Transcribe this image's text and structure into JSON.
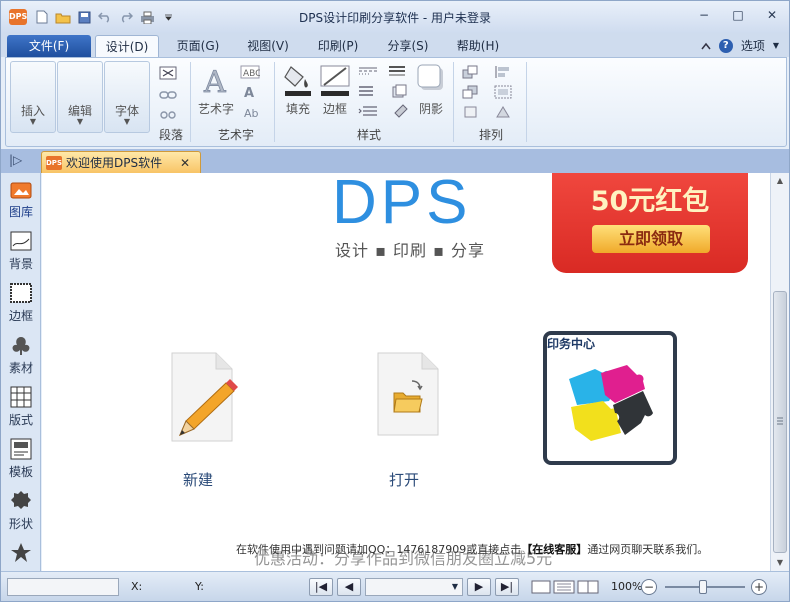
{
  "window": {
    "app_logo": "DPS",
    "title": "DPS设计印刷分享软件 - 用户未登录",
    "controls": {
      "minimize": "−",
      "restore": "□",
      "close": "✕"
    }
  },
  "quick_access": [
    "new-doc-icon",
    "open-folder-icon",
    "save-icon",
    "undo-icon",
    "redo-icon",
    "print-icon",
    "customize-arrow-icon"
  ],
  "ribbon_tabs": {
    "file": "文件(F)",
    "tabs": [
      {
        "label": "设计(D)",
        "active": true
      },
      {
        "label": "页面(G)",
        "active": false
      },
      {
        "label": "视图(V)",
        "active": false
      },
      {
        "label": "印刷(P)",
        "active": false
      },
      {
        "label": "分享(S)",
        "active": false
      },
      {
        "label": "帮助(H)",
        "active": false
      }
    ],
    "options_label": "选项",
    "help_glyph": "?"
  },
  "ribbon": {
    "insert": "插入",
    "edit": "编辑",
    "font": "字体",
    "paragraph_group": "段落",
    "wordart_button": "艺术字",
    "wordart_group": "艺术字",
    "fill": "填充",
    "border": "边框",
    "style_group": "样式",
    "shadow": "阴影",
    "arrange_group": "排列",
    "dropdown_glyph": "▼"
  },
  "doc_tab": {
    "logo": "DPS",
    "label": "欢迎使用DPS软件",
    "close": "✕",
    "panel_toggle": "|▷"
  },
  "left_panel": [
    {
      "label": "图库",
      "icon": "gallery-icon",
      "active": true
    },
    {
      "label": "背景",
      "icon": "background-icon",
      "active": false
    },
    {
      "label": "边框",
      "icon": "frame-icon",
      "active": false
    },
    {
      "label": "素材",
      "icon": "material-icon",
      "active": false
    },
    {
      "label": "版式",
      "icon": "layout-icon",
      "active": false
    },
    {
      "label": "模板",
      "icon": "template-icon",
      "active": false
    },
    {
      "label": "形状",
      "icon": "shape-icon",
      "active": false
    },
    {
      "label": "",
      "icon": "star-icon",
      "active": false
    }
  ],
  "welcome": {
    "logo": "DPS",
    "tagline": "设计 ▪ 印刷 ▪ 分享",
    "promo_amount": "50元红包",
    "promo_claim": "立即领取",
    "cards": {
      "new": "新建",
      "open": "打开",
      "print_center": "印务中心"
    },
    "notice_prefix": "在软件使用中遇到问题请加QQ：1476187909或直接点击",
    "notice_bold": "【在线客服】",
    "notice_suffix": "通过网页聊天联系我们。",
    "promo_overlay": "优惠活动：分享作品到微信朋友圈立减5元"
  },
  "status": {
    "x_label": "X:",
    "y_label": "Y:",
    "zoom": "100%",
    "zoom_out": "−",
    "zoom_in": "+",
    "nav": {
      "first": "|◀",
      "prev": "◀",
      "next": "▶",
      "last": "▶|"
    },
    "page_select_arrow": "▼"
  },
  "colors": {
    "accent": "#2e8fe0",
    "file_tab": "#2a5db0",
    "promo_red": "#e0352e",
    "doc_tab": "#f8c466"
  }
}
